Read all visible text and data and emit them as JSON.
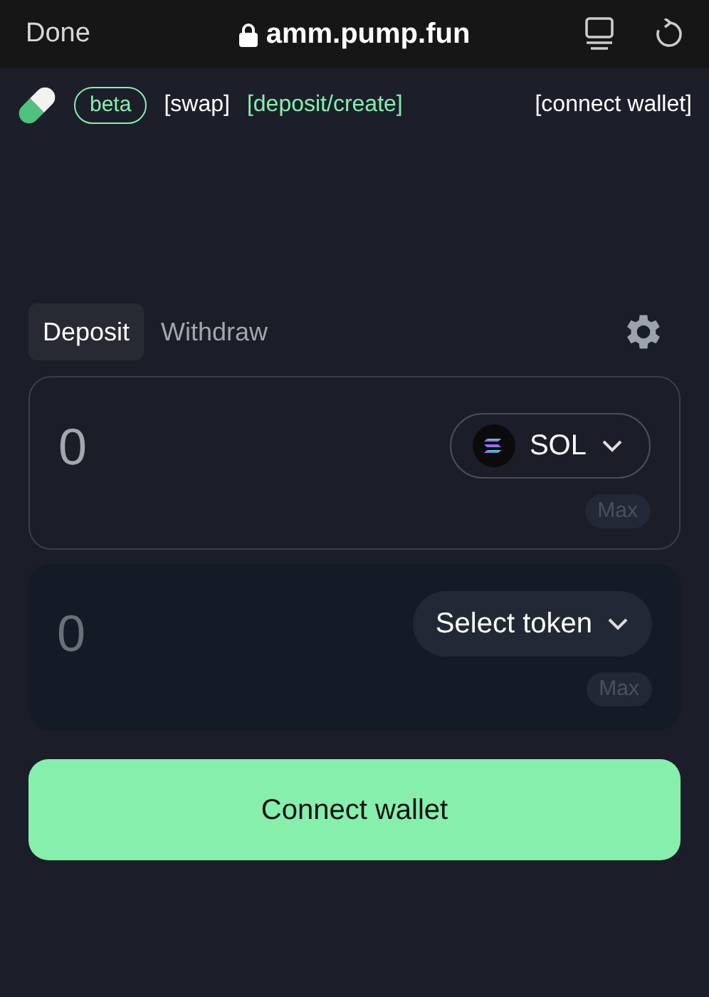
{
  "browser_bar": {
    "done": "Done",
    "url": "amm.pump.fun"
  },
  "nav": {
    "badge": "beta",
    "links": [
      {
        "label": "[swap]",
        "selected": false
      },
      {
        "label": "[deposit/create]",
        "selected": true
      }
    ],
    "wallet": "[connect wallet]"
  },
  "tabs": [
    {
      "label": "Deposit",
      "selected": true
    },
    {
      "label": "Withdraw",
      "selected": false
    }
  ],
  "panels": [
    {
      "placeholder": "0",
      "focused": true,
      "token": {
        "kind": "sol",
        "label": "SOL"
      },
      "max": "Max"
    },
    {
      "placeholder": "0",
      "focused": false,
      "token": {
        "kind": "select",
        "label": "Select token"
      },
      "max": "Max"
    }
  ],
  "action_button": "Connect wallet"
}
